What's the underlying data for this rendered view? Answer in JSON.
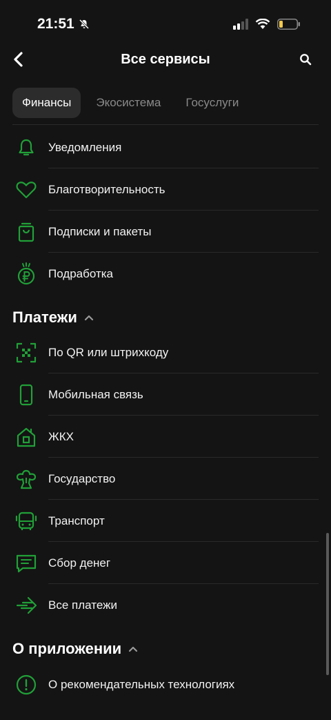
{
  "status": {
    "time": "21:51"
  },
  "nav": {
    "title": "Все сервисы"
  },
  "tabs": [
    "Финансы",
    "Экосистема",
    "Госуслуги"
  ],
  "colors": {
    "accent": "#21a038",
    "background": "#141414"
  },
  "items_top": [
    {
      "label": "Уведомления",
      "icon": "bell-icon"
    },
    {
      "label": "Благотворительность",
      "icon": "heart-icon"
    },
    {
      "label": "Подписки и пакеты",
      "icon": "bag-icon"
    },
    {
      "label": "Подработка",
      "icon": "ruble-coin-icon"
    }
  ],
  "sections": {
    "payments": {
      "title": "Платежи",
      "items": [
        {
          "label": "По QR или штрихкоду",
          "icon": "qr-scan-icon"
        },
        {
          "label": "Мобильная связь",
          "icon": "phone-icon"
        },
        {
          "label": "ЖКХ",
          "icon": "house-icon"
        },
        {
          "label": "Государство",
          "icon": "government-icon"
        },
        {
          "label": "Транспорт",
          "icon": "bus-icon"
        },
        {
          "label": "Сбор денег",
          "icon": "chat-icon"
        },
        {
          "label": "Все платежи",
          "icon": "arrow-right-icon"
        }
      ]
    },
    "about": {
      "title": "О приложении",
      "items": [
        {
          "label": "О рекомендательных технологиях",
          "icon": "info-circle-icon"
        }
      ]
    }
  }
}
